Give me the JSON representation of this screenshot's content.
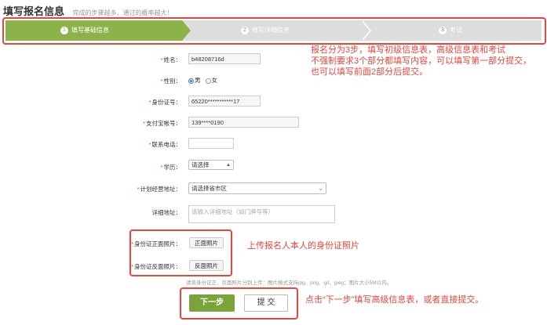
{
  "header": {
    "title": "填写报名信息",
    "subtitle": "完成的步骤越多，通过的概率越大！"
  },
  "steps": [
    {
      "num": "1",
      "label": "填写基础信息"
    },
    {
      "num": "2",
      "label": "填写详细信息"
    },
    {
      "num": "3",
      "label": "考试"
    }
  ],
  "form": {
    "name": {
      "label": "姓名：",
      "value": "b48208716d"
    },
    "gender": {
      "label": "性别：",
      "male": "男",
      "female": "女",
      "selected": "男"
    },
    "id_number": {
      "label": "身份证号：",
      "value": "65220***********17"
    },
    "alipay": {
      "label": "支付宝帐号：",
      "value": "139****0190"
    },
    "phone": {
      "label": "联系电话：",
      "value": ""
    },
    "education": {
      "label": "学历：",
      "value": "请选择"
    },
    "business_address": {
      "label": "计划经营地址：",
      "value": "请选择省市区"
    },
    "detail_address": {
      "label": "详细地址：",
      "placeholder": "请输入详细地址（如门牌号等）"
    },
    "id_front": {
      "label": "身份证正面照片：",
      "button": "正面照片"
    },
    "id_back": {
      "label": "身份证反面照片：",
      "button": "反面照片"
    },
    "photo_note": "请将身份证正、反面照片分别上传：图片格式支持jpg、png、gif、jpeg；图片大小5M以内。"
  },
  "buttons": {
    "next": "下一步",
    "submit": "提 交"
  },
  "annotations": {
    "steps_note_1": "报名分为3步，填写初级信息表，高级信息表和考试",
    "steps_note_2": "不强制要求3个部分都填写内容，可以填写第一部分提交，",
    "steps_note_3": "也可以填写前面2部分后提交。",
    "photo_note": "上传报名人本人的身份证照片",
    "button_note": "点击“下一步”填写高级信息表，或者直接提交。"
  },
  "colors": {
    "accent": "#8cb34a",
    "annotation": "#e8473c"
  }
}
